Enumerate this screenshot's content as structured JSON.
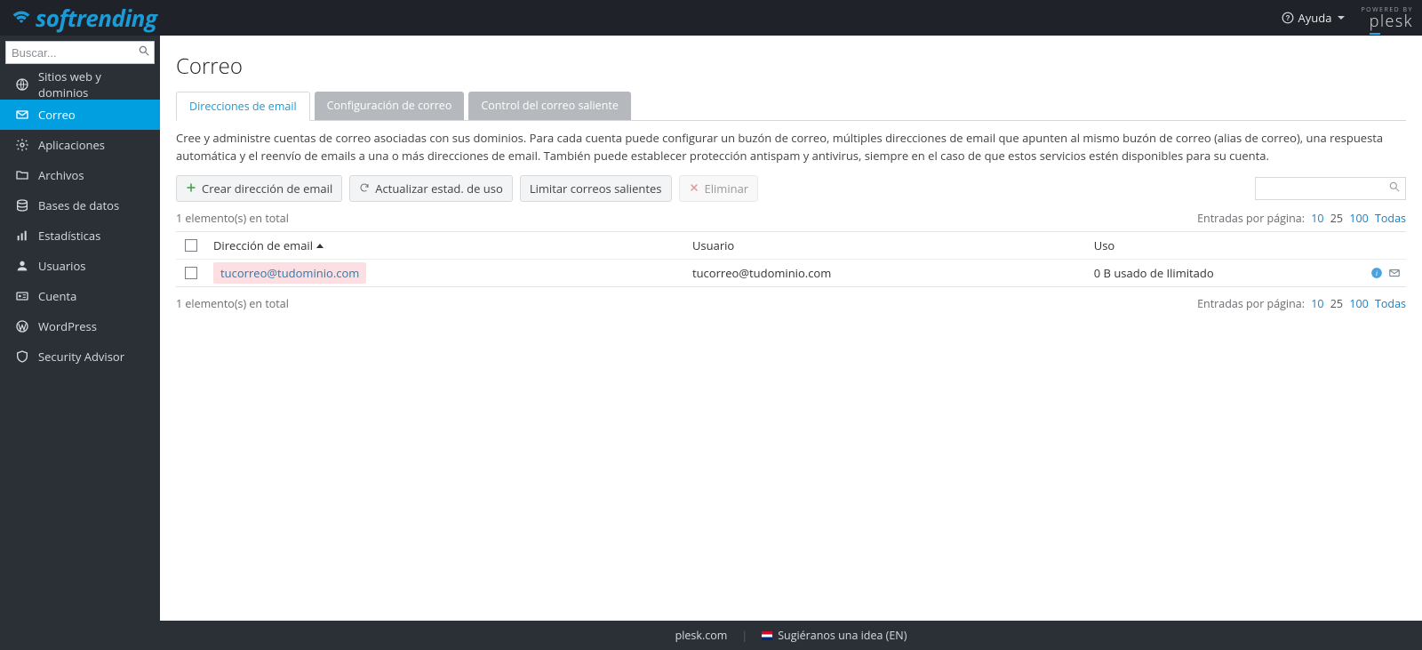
{
  "header": {
    "help_label": "Ayuda",
    "powered_by": "POWERED BY",
    "plesk": "plesk",
    "help_float": "?"
  },
  "sidebar": {
    "search_placeholder": "Buscar...",
    "items": [
      {
        "label": "Sitios web y dominios",
        "icon": "globe"
      },
      {
        "label": "Correo",
        "icon": "mail",
        "active": true
      },
      {
        "label": "Aplicaciones",
        "icon": "gear"
      },
      {
        "label": "Archivos",
        "icon": "folder"
      },
      {
        "label": "Bases de datos",
        "icon": "db"
      },
      {
        "label": "Estadísticas",
        "icon": "stats"
      },
      {
        "label": "Usuarios",
        "icon": "user"
      },
      {
        "label": "Cuenta",
        "icon": "card"
      },
      {
        "label": "WordPress",
        "icon": "wp"
      },
      {
        "label": "Security Advisor",
        "icon": "shield"
      }
    ]
  },
  "page": {
    "title": "Correo",
    "tabs": [
      {
        "label": "Direcciones de email",
        "active": true
      },
      {
        "label": "Configuración de correo"
      },
      {
        "label": "Control del correo saliente"
      }
    ],
    "description": "Cree y administre cuentas de correo asociadas con sus dominios. Para cada cuenta puede configurar un buzón de correo, múltiples direcciones de email que apunten al mismo buzón de correo (alias de correo), una respuesta automática y el reenvío de emails a una o más direcciones de email. También puede establecer protección antispam y antivirus, siempre en el caso de que estos servicios estén disponibles para su cuenta.",
    "toolbar": {
      "create": "Crear dirección de email",
      "update": "Actualizar estad. de uso",
      "limit": "Limitar correos salientes",
      "delete": "Eliminar"
    },
    "count_text": "1 elemento(s) en total",
    "perpage": {
      "label": "Entradas por página:",
      "options": [
        "10",
        "25",
        "100",
        "Todas"
      ],
      "current": "25"
    },
    "table": {
      "columns": {
        "email": "Dirección de email",
        "user": "Usuario",
        "usage": "Uso"
      },
      "rows": [
        {
          "email": "tucorreo@tudominio.com",
          "user": "tucorreo@tudominio.com",
          "usage": "0 B usado de Ilimitado"
        }
      ]
    }
  },
  "footer": {
    "plesk_link": "plesk.com",
    "suggest": "Sugiéranos una idea (EN)"
  }
}
